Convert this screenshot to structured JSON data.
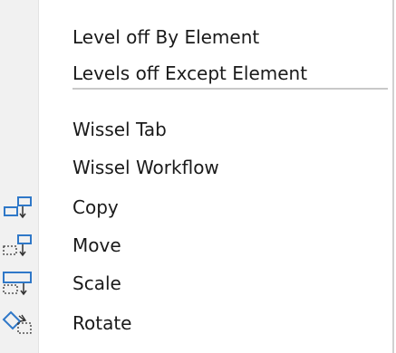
{
  "menu": {
    "items": [
      {
        "id": "level-off-by-element",
        "label": "Level off By Element",
        "icon": null
      },
      {
        "id": "levels-off-except-element",
        "label": "Levels off Except Element",
        "icon": null
      },
      {
        "id": "wissel-tab",
        "label": "Wissel Tab",
        "icon": null
      },
      {
        "id": "wissel-workflow",
        "label": "Wissel Workflow",
        "icon": null
      },
      {
        "id": "copy",
        "label": "Copy",
        "icon": "copy-icon"
      },
      {
        "id": "move",
        "label": "Move",
        "icon": "move-icon"
      },
      {
        "id": "scale",
        "label": "Scale",
        "icon": "scale-icon"
      },
      {
        "id": "rotate",
        "label": "Rotate",
        "icon": "rotate-icon"
      }
    ]
  },
  "colors": {
    "gutter": "#f1f1f1",
    "text": "#1a1a1a",
    "icon_blue": "#2f78c8",
    "icon_dark": "#333333"
  }
}
